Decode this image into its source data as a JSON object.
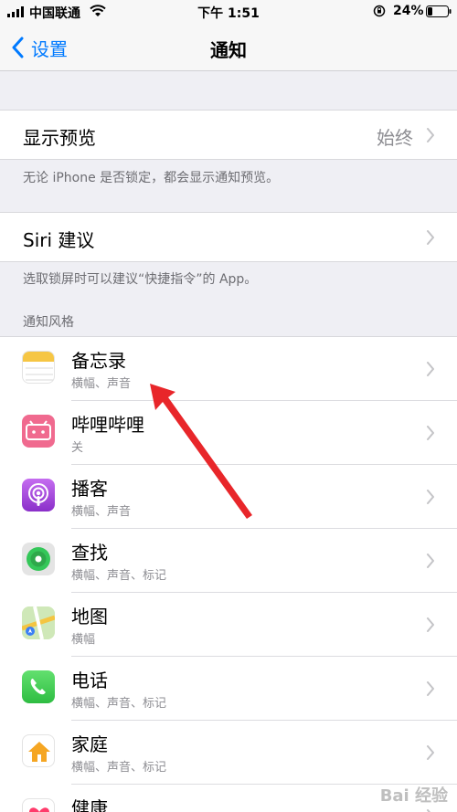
{
  "status_bar": {
    "carrier": "中国联通",
    "time": "下午 1:51",
    "battery_percent": "24%",
    "battery_level": 0.24,
    "icons": [
      "signal-icon",
      "wifi-icon",
      "orientation-lock-icon",
      "battery-icon"
    ]
  },
  "nav": {
    "back_label": "设置",
    "title": "通知"
  },
  "preview": {
    "label": "显示预览",
    "value": "始终",
    "footnote": "无论 iPhone 是否锁定，都会显示通知预览。"
  },
  "siri": {
    "label": "Siri 建议",
    "footnote": "选取锁屏时可以建议“快捷指令”的 App。"
  },
  "section_header": "通知风格",
  "apps": [
    {
      "name": "备忘录",
      "detail": "横幅、声音",
      "icon": "notes-icon"
    },
    {
      "name": "哔哩哔哩",
      "detail": "关",
      "icon": "bilibili-icon"
    },
    {
      "name": "播客",
      "detail": "横幅、声音",
      "icon": "podcasts-icon"
    },
    {
      "name": "查找",
      "detail": "横幅、声音、标记",
      "icon": "find-my-icon"
    },
    {
      "name": "地图",
      "detail": "横幅",
      "icon": "maps-icon"
    },
    {
      "name": "电话",
      "detail": "横幅、声音、标记",
      "icon": "phone-icon"
    },
    {
      "name": "家庭",
      "detail": "横幅、声音、标记",
      "icon": "home-icon"
    },
    {
      "name": "健康",
      "detail": "",
      "icon": "health-icon"
    }
  ],
  "colors": {
    "accent": "#007aff",
    "background": "#efeff4",
    "annotation_arrow": "#e8262a"
  },
  "watermark": "Bai 经验"
}
